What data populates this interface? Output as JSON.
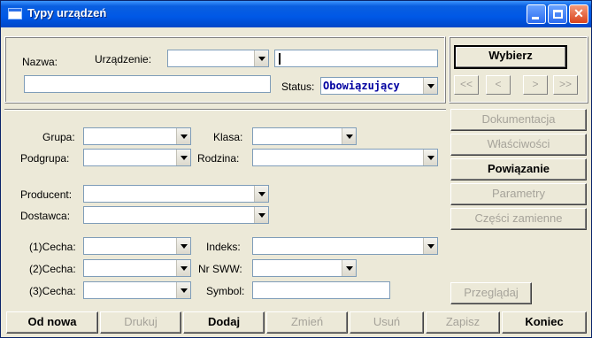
{
  "window": {
    "title": "Typy urządzeń"
  },
  "header": {
    "nazwa_label": "Nazwa:",
    "urzadzenie_label": "Urządzenie:",
    "urzadzenie_value": "",
    "search_value": "",
    "nazwa_value": "",
    "status_label": "Status:",
    "status_value": "Obowiązujący"
  },
  "side": {
    "wybierz": "Wybierz",
    "nav_first": "<<",
    "nav_prev": "<",
    "nav_next": ">",
    "nav_last": ">>",
    "dokumentacja": "Dokumentacja",
    "wlasciwosci": "Właściwości",
    "powiazanie": "Powiązanie",
    "parametry": "Parametry",
    "czesci": "Części zamienne",
    "przegladaj": "Przeglądaj"
  },
  "form": {
    "grupa": "Grupa:",
    "klasa": "Klasa:",
    "podgrupa": "Podgrupa:",
    "rodzina": "Rodzina:",
    "producent": "Producent:",
    "dostawca": "Dostawca:",
    "cecha1": "(1)Cecha:",
    "indeks": "Indeks:",
    "cecha2": "(2)Cecha:",
    "nr_sww": "Nr SWW:",
    "cecha3": "(3)Cecha:",
    "symbol": "Symbol:"
  },
  "footer": {
    "od_nowa": "Od nowa",
    "drukuj": "Drukuj",
    "dodaj": "Dodaj",
    "zmien": "Zmień",
    "usun": "Usuń",
    "zapisz": "Zapisz",
    "koniec": "Koniec"
  },
  "colors": {
    "titlebar": "#0058e6",
    "face": "#ece9d8",
    "status_text": "#0000a0",
    "disabled_text": "#a6a39a"
  },
  "icons": [
    "window-icon",
    "minimize-icon",
    "maximize-icon",
    "close-icon",
    "dropdown-arrow-icon"
  ]
}
